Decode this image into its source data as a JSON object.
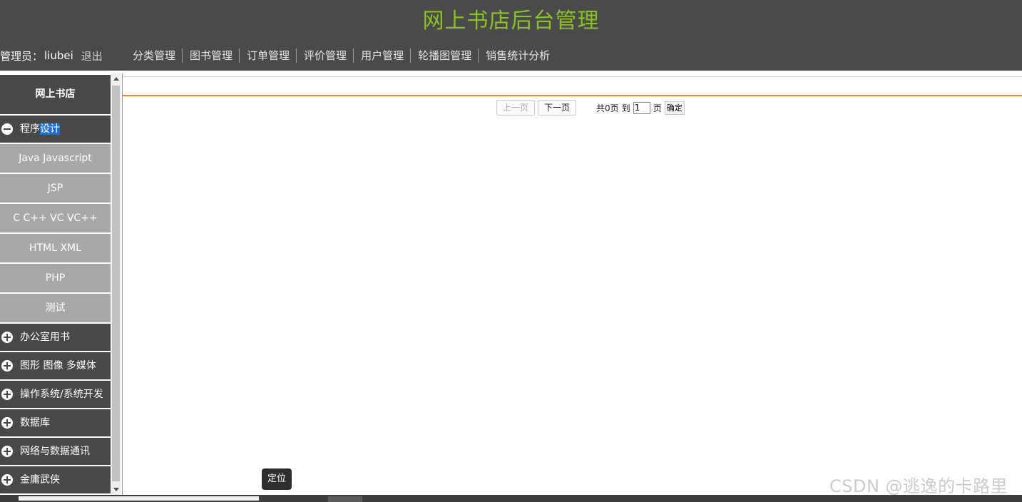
{
  "header": {
    "site_title": "网上书店后台管理",
    "admin_label": "管理员：",
    "admin_name": "liubei",
    "logout_label": "退出",
    "nav": [
      {
        "label": "分类管理"
      },
      {
        "label": "图书管理"
      },
      {
        "label": "订单管理"
      },
      {
        "label": "评价管理"
      },
      {
        "label": "用户管理"
      },
      {
        "label": "轮播图管理"
      },
      {
        "label": "销售统计分析"
      }
    ]
  },
  "sidebar": {
    "title": "网上书店",
    "categories": [
      {
        "label_plain": "程序",
        "label_selected": "设计",
        "expanded": true,
        "icon": "minus-circle-icon",
        "children": [
          {
            "label": "Java Javascript"
          },
          {
            "label": "JSP"
          },
          {
            "label": "C C++ VC VC++"
          },
          {
            "label": "HTML XML"
          },
          {
            "label": "PHP"
          },
          {
            "label": "测试"
          }
        ]
      },
      {
        "label": "办公室用书",
        "icon": "plus-circle-icon"
      },
      {
        "label": "图形 图像 多媒体",
        "icon": "plus-circle-icon"
      },
      {
        "label": "操作系统/系统开发",
        "icon": "plus-circle-icon"
      },
      {
        "label": "数据库",
        "icon": "plus-circle-icon"
      },
      {
        "label": "网络与数据通讯",
        "icon": "plus-circle-icon"
      },
      {
        "label": "金庸武侠",
        "icon": "plus-circle-icon"
      }
    ]
  },
  "pager": {
    "prev_label": "上一页",
    "next_label": "下一页",
    "total_text": "共0页",
    "to_text": "到",
    "page_value": "1",
    "unit_text": "页",
    "confirm_label": "确定"
  },
  "locate_label": "定位",
  "watermark": "CSDN @逃逸的卡路里",
  "colors": {
    "header_bg": "#4a4a4a",
    "title_green": "#8ac226",
    "sidebar_dark": "#484848",
    "sidebar_light": "#a8a8a8",
    "accent_orange": "#f08a2c",
    "selection_blue": "#1e6fd0"
  }
}
